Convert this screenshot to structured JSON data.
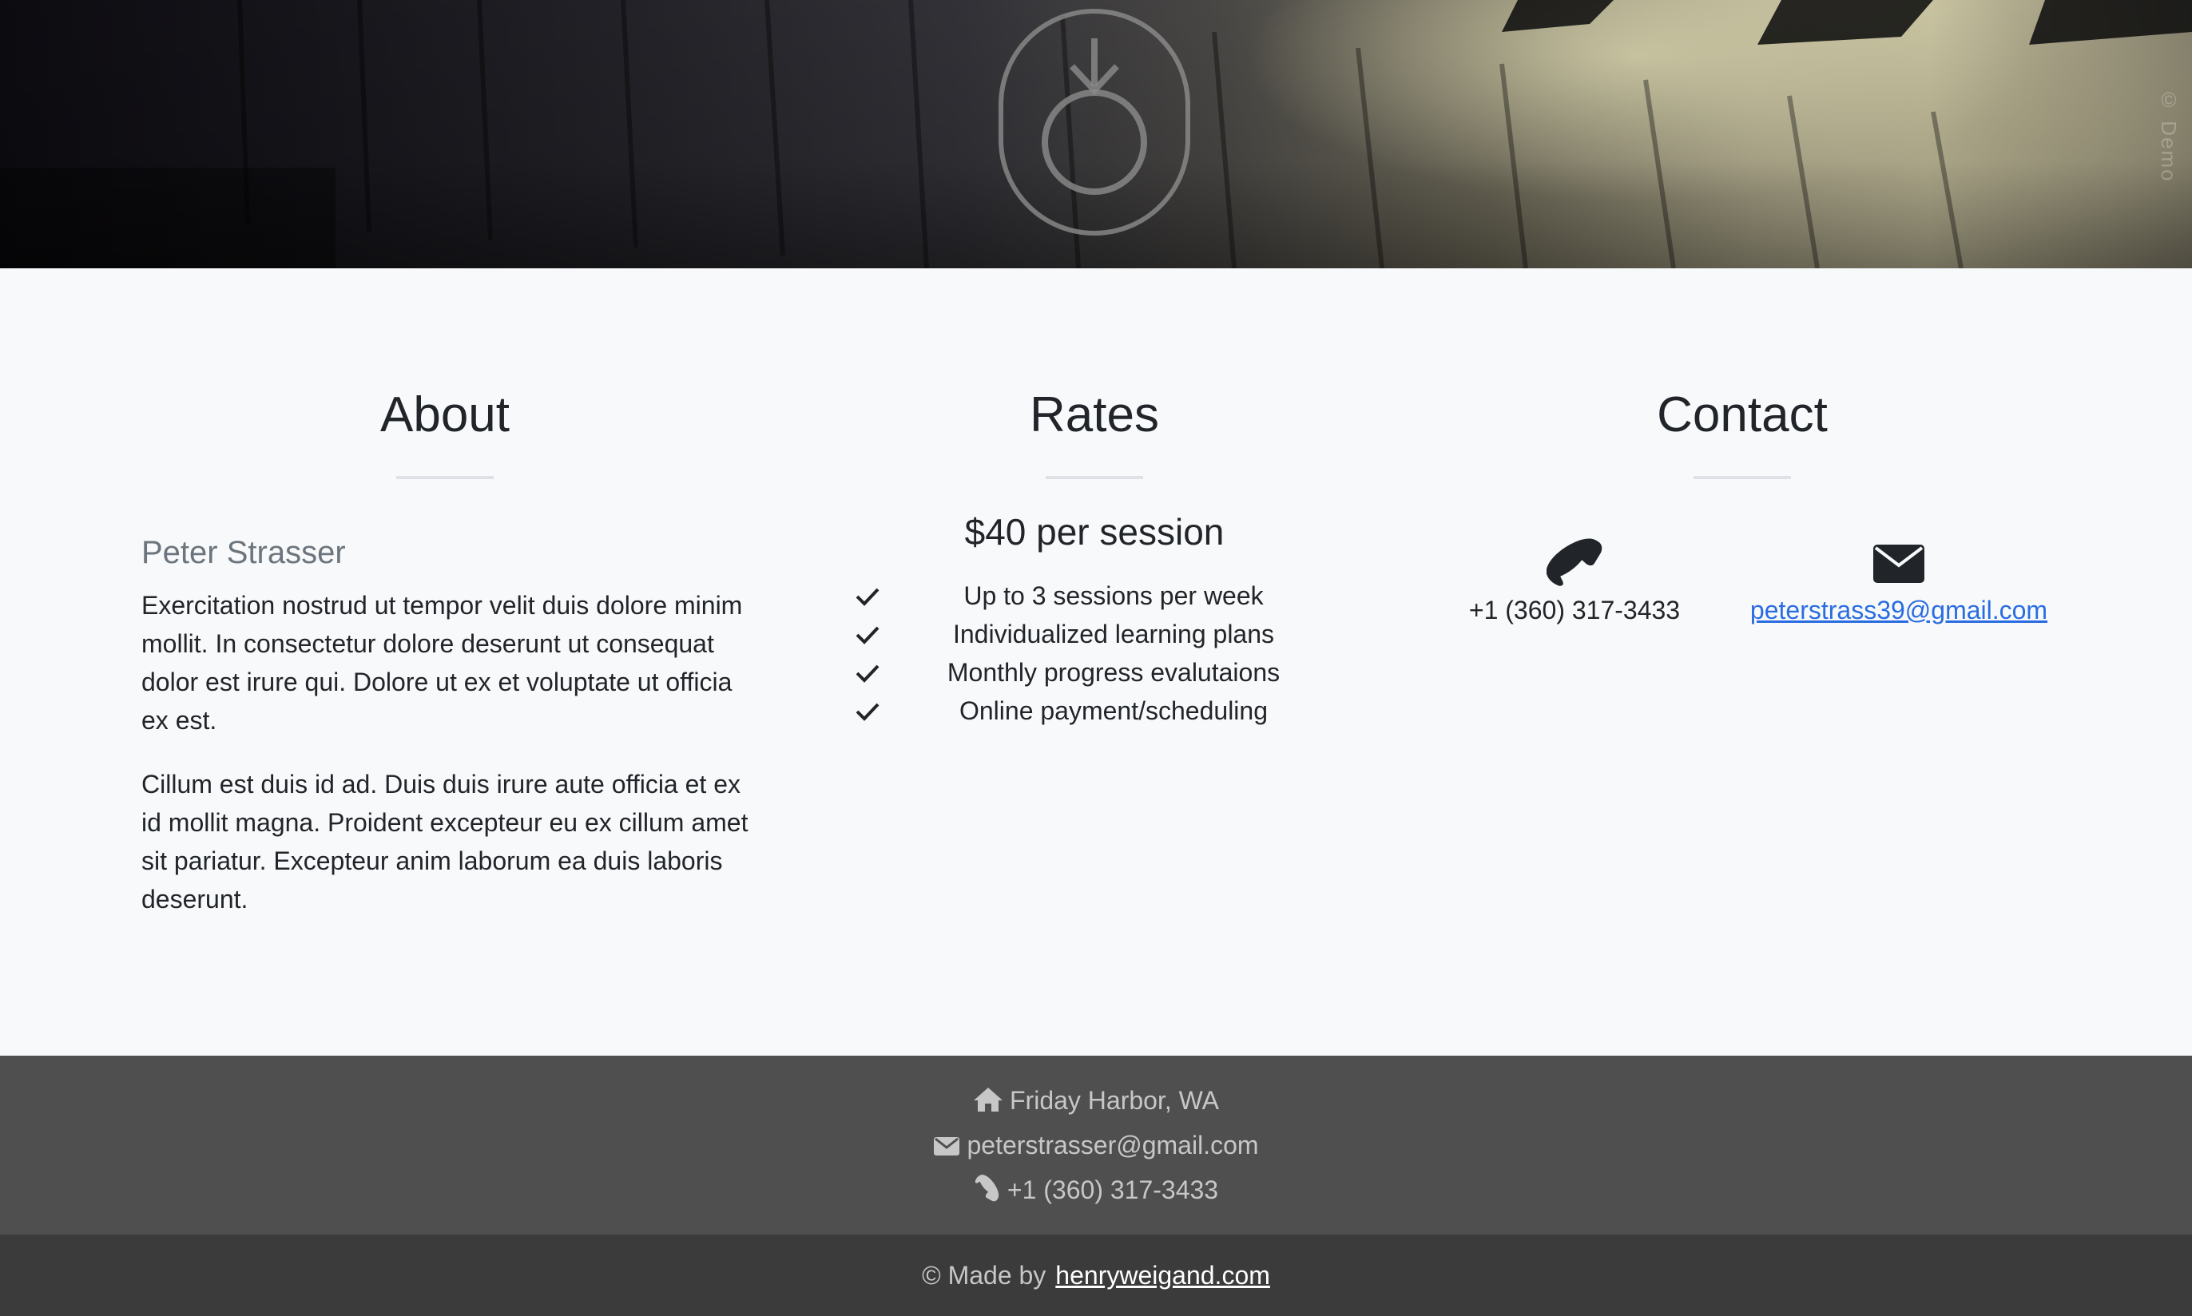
{
  "hero": {
    "logo_icon": "ring-with-arrow-logo",
    "watermark_text": "© Demo"
  },
  "about": {
    "title": "About",
    "name": "Peter Strasser",
    "paragraphs": [
      "Exercitation nostrud ut tempor velit duis dolore minim mollit. In consectetur dolore deserunt ut consequat dolor est irure qui. Dolore ut ex et voluptate ut officia ex est.",
      "Cillum est duis id ad. Duis duis irure aute officia et ex id mollit magna. Proident excepteur eu ex cillum amet sit pariatur. Excepteur anim laborum ea duis laboris deserunt."
    ]
  },
  "rates": {
    "title": "Rates",
    "price": "$40 per session",
    "features": [
      "Up to 3 sessions per week",
      "Individualized learning plans",
      "Monthly progress evalutaions",
      "Online payment/scheduling"
    ]
  },
  "contact": {
    "title": "Contact",
    "phone": "+1 (360) 317-3433",
    "email": "peterstrass39@gmail.com"
  },
  "footer": {
    "location": "Friday Harbor, WA",
    "email": "peterstrasser@gmail.com",
    "phone": "+1 (360) 317-3433",
    "made_by_prefix": "© Made by",
    "made_by_link": "henryweigand.com"
  },
  "colors": {
    "section_bg": "#f8f9fa",
    "footer_info_bg": "#4f4f4f",
    "footer_bottom_bg": "#3b3b3b",
    "link": "#2a6de0"
  }
}
